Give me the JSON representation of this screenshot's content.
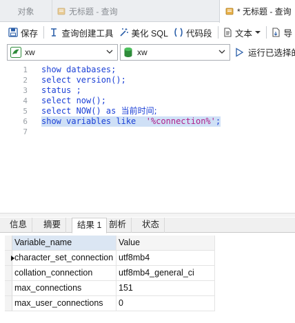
{
  "tabs": {
    "objects": "对象",
    "untitled_query": "无标题 - 查询",
    "active_query": "* 无标题 - 查询"
  },
  "toolbar": {
    "save": "保存",
    "query_builder": "查询创建工具",
    "beautify": "美化 SQL",
    "snippet": "代码段",
    "text": "文本",
    "export": "导"
  },
  "selectors": {
    "connection": "xw",
    "database": "xw",
    "run_selected": "运行已选择的"
  },
  "editor": {
    "lines": [
      {
        "num": "1",
        "parts": [
          {
            "t": "show databases;",
            "c": "kw"
          }
        ]
      },
      {
        "num": "2",
        "parts": [
          {
            "t": "select version();",
            "c": "kw"
          }
        ]
      },
      {
        "num": "3",
        "parts": [
          {
            "t": "status ;",
            "c": "kw"
          }
        ]
      },
      {
        "num": "4",
        "parts": [
          {
            "t": "select now();",
            "c": "kw"
          }
        ]
      },
      {
        "num": "5",
        "parts": [
          {
            "t": "select NOW() as ",
            "c": "kw"
          },
          {
            "t": "当前时间;",
            "c": "cn"
          }
        ]
      },
      {
        "num": "6",
        "parts": [
          {
            "t": "show variables like  ",
            "c": "kw"
          },
          {
            "t": "'%connection%'",
            "c": "str"
          },
          {
            "t": ";",
            "c": "kw"
          }
        ],
        "selected": true
      },
      {
        "num": "7",
        "parts": []
      }
    ]
  },
  "result_tabs": [
    "信息",
    "摘要",
    "结果 1",
    "剖析",
    "状态"
  ],
  "result_active_index": 2,
  "grid": {
    "columns": [
      "Variable_name",
      "Value"
    ],
    "rows": [
      [
        "character_set_connection",
        "utf8mb4"
      ],
      [
        "collation_connection",
        "utf8mb4_general_ci"
      ],
      [
        "max_connections",
        "151"
      ],
      [
        "max_user_connections",
        "0"
      ]
    ],
    "current_row": 0
  },
  "colors": {
    "keyword": "#1a3fd6",
    "string": "#b0208a",
    "selection": "#cfe0f6",
    "header_selected": "#dbe6f3"
  }
}
